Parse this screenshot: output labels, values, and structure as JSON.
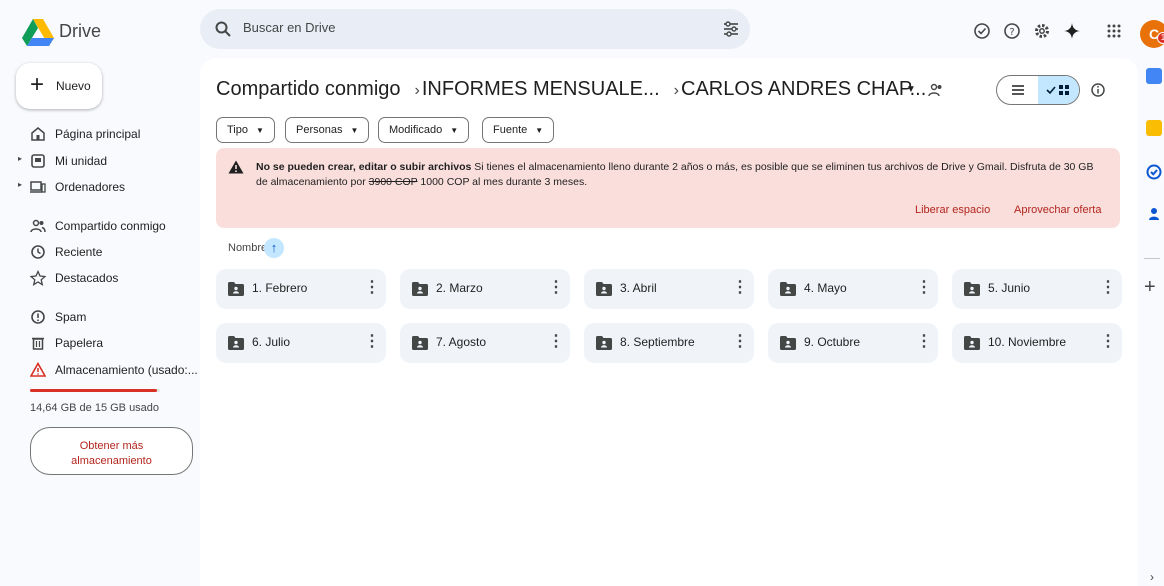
{
  "app": {
    "name": "Drive"
  },
  "search": {
    "placeholder": "Buscar en Drive"
  },
  "user": {
    "initial": "C",
    "badge": "1"
  },
  "sidebar": {
    "new_label": "Nuevo",
    "items": [
      {
        "label": "Página principal",
        "icon": "home-icon"
      },
      {
        "label": "Mi unidad",
        "icon": "drive-icon"
      },
      {
        "label": "Ordenadores",
        "icon": "computer-icon"
      },
      {
        "label": "Compartido conmigo",
        "icon": "shared-icon"
      },
      {
        "label": "Reciente",
        "icon": "clock-icon"
      },
      {
        "label": "Destacados",
        "icon": "star-icon"
      },
      {
        "label": "Spam",
        "icon": "spam-icon"
      },
      {
        "label": "Papelera",
        "icon": "trash-icon"
      },
      {
        "label": "Almacenamiento (usado:...",
        "icon": "warning-icon"
      }
    ],
    "storage_text": "14,64 GB de 15 GB usado",
    "storage_used_fraction": 0.976,
    "get_more_line1": "Obtener más",
    "get_more_line2": "almacenamiento"
  },
  "breadcrumb": {
    "items": [
      "Compartido conmigo",
      "INFORMES MENSUALE...",
      "CARLOS ANDRES CHAP..."
    ],
    "separator": "›"
  },
  "filters": [
    "Tipo",
    "Personas",
    "Modificado",
    "Fuente"
  ],
  "banner": {
    "title": "No se pueden crear, editar o subir archivos",
    "text1": " Si tienes el almacenamiento lleno durante 2 años o más, es posible que se eliminen tus archivos de Drive y Gmail. Disfruta de 30 GB de almacenamiento por ",
    "old_price": "3900 COP",
    "text2": " 1000 COP al mes durante 3 meses.",
    "link1": "Liberar espacio",
    "link2": "Aprovechar oferta"
  },
  "sort": {
    "label": "Nombre"
  },
  "folders": [
    "1. Febrero",
    "2. Marzo",
    "3. Abril",
    "4. Mayo",
    "5. Junio",
    "6. Julio",
    "7. Agosto",
    "8. Septiembre",
    "9. Octubre",
    "10. Noviembre"
  ],
  "colors": {
    "accent": "#0b57d0",
    "warning": "#d93025",
    "banner_bg": "#f9dedc",
    "selected": "#c2e7ff"
  }
}
